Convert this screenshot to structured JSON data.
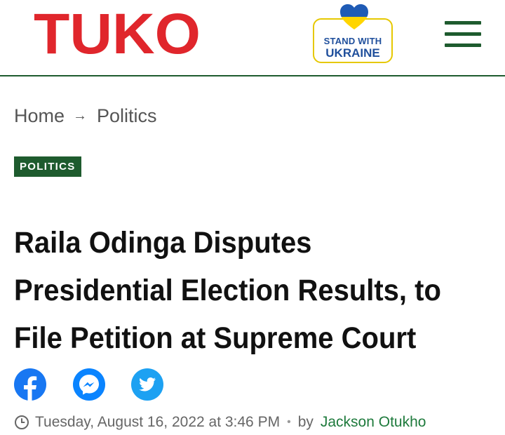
{
  "header": {
    "logo_text": "TUKO",
    "ukraine_badge": {
      "line1": "STAND WITH",
      "line2": "UKRAINE"
    }
  },
  "breadcrumb": {
    "home": "Home",
    "separator": "→",
    "section": "Politics"
  },
  "category_tag": "POLITICS",
  "headline": "Raila Odinga Disputes Presidential Election Results, to File Petition at Supreme Court",
  "share_icons": [
    "facebook-icon",
    "messenger-icon",
    "twitter-icon"
  ],
  "meta": {
    "date": "Tuesday, August 16, 2022 at 3:46 PM",
    "separator": "•",
    "by": "by",
    "author": "Jackson Otukho"
  },
  "colors": {
    "brand_red": "#e0262c",
    "brand_green": "#1e5b2e",
    "author_green": "#1e7a3c",
    "facebook": "#1877f2",
    "messenger": "#0a84ff",
    "twitter": "#1da1f2"
  }
}
